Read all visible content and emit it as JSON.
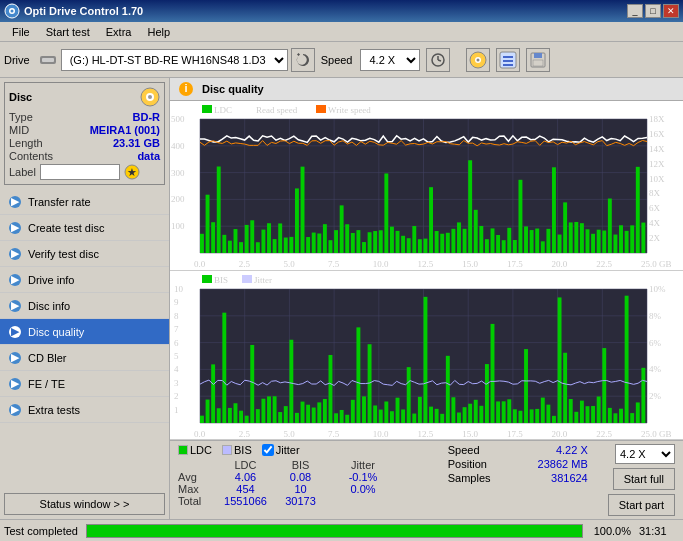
{
  "app": {
    "title": "Opti Drive Control 1.70",
    "icon": "disc-icon"
  },
  "titlebar": {
    "minimize_label": "_",
    "maximize_label": "□",
    "close_label": "✕"
  },
  "menu": {
    "items": [
      "File",
      "Start test",
      "Extra",
      "Help"
    ]
  },
  "toolbar": {
    "drive_label": "Drive",
    "drive_value": "(G:)  HL-DT-ST BD-RE  WH16NS48 1.D3",
    "speed_label": "Speed",
    "speed_value": "4.2 X"
  },
  "disc": {
    "title": "Disc",
    "type_label": "Type",
    "type_value": "BD-R",
    "mid_label": "MID",
    "mid_value": "MEIRA1 (001)",
    "length_label": "Length",
    "length_value": "23.31 GB",
    "contents_label": "Contents",
    "contents_value": "data",
    "label_label": "Label",
    "label_value": ""
  },
  "nav": {
    "items": [
      {
        "id": "transfer-rate",
        "label": "Transfer rate"
      },
      {
        "id": "create-test-disc",
        "label": "Create test disc"
      },
      {
        "id": "verify-test-disc",
        "label": "Verify test disc"
      },
      {
        "id": "drive-info",
        "label": "Drive info"
      },
      {
        "id": "disc-info",
        "label": "Disc info"
      },
      {
        "id": "disc-quality",
        "label": "Disc quality",
        "active": true
      },
      {
        "id": "cd-bler",
        "label": "CD Bler"
      },
      {
        "id": "fe-te",
        "label": "FE / TE"
      },
      {
        "id": "extra-tests",
        "label": "Extra tests"
      }
    ],
    "status_window": "Status window > >"
  },
  "chart": {
    "title": "Disc quality",
    "legend": {
      "ldc_label": "LDC",
      "ldc_color": "#00cc00",
      "read_speed_label": "Read speed",
      "read_speed_color": "#ffffff",
      "write_speed_label": "Write speed",
      "write_speed_color": "#ff6600",
      "bis_label": "BIS",
      "bis_color": "#00cc00",
      "jitter_label": "Jitter",
      "jitter_color": "#ccccff"
    },
    "top": {
      "y_max": 500,
      "y_min": 0,
      "x_max": 25.0,
      "y_labels": [
        "500",
        "400",
        "300",
        "200",
        "100"
      ],
      "y_labels_right": [
        "18X",
        "16X",
        "14X",
        "12X",
        "10X",
        "8X",
        "6X",
        "4X",
        "2X"
      ],
      "x_labels": [
        "0.0",
        "2.5",
        "5.0",
        "7.5",
        "10.0",
        "12.5",
        "15.0",
        "17.5",
        "20.0",
        "22.5",
        "25.0 GB"
      ]
    },
    "bottom": {
      "y_max": 10,
      "y_min": 0,
      "x_max": 25.0,
      "y_labels": [
        "10",
        "9",
        "8",
        "7",
        "6",
        "5",
        "4",
        "3",
        "2",
        "1"
      ],
      "y_labels_right": [
        "10%",
        "8%",
        "6%",
        "4%",
        "2%"
      ],
      "x_labels": [
        "0.0",
        "2.5",
        "5.0",
        "7.5",
        "10.0",
        "12.5",
        "15.0",
        "17.5",
        "20.0",
        "22.5",
        "25.0 GB"
      ]
    }
  },
  "stats": {
    "ldc_label": "LDC",
    "bis_label": "BIS",
    "jitter_label": "Jitter",
    "jitter_checked": true,
    "avg_label": "Avg",
    "avg_ldc": "4.06",
    "avg_bis": "0.08",
    "avg_jitter": "-0.1%",
    "max_label": "Max",
    "max_ldc": "454",
    "max_bis": "10",
    "max_jitter": "0.0%",
    "total_label": "Total",
    "total_ldc": "1551066",
    "total_bis": "30173",
    "speed_label": "Speed",
    "speed_value": "4.22 X",
    "position_label": "Position",
    "position_value": "23862 MB",
    "samples_label": "Samples",
    "samples_value": "381624",
    "speed_select_value": "4.2 X",
    "start_full_label": "Start full",
    "start_part_label": "Start part"
  },
  "statusbar": {
    "status_text": "Test completed",
    "progress_pct": 100,
    "progress_label": "100.0%",
    "time_label": "31:31"
  }
}
